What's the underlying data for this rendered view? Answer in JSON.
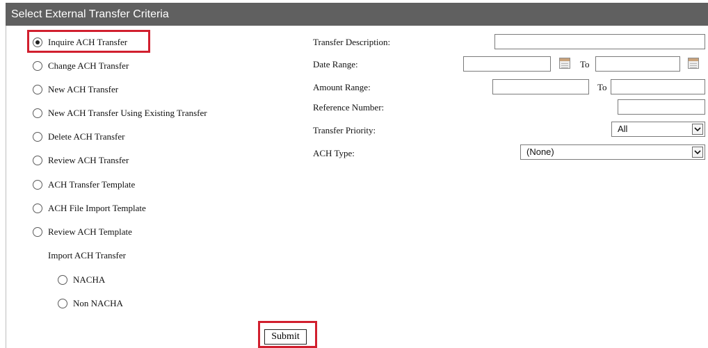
{
  "panel": {
    "title": "Select External Transfer Criteria"
  },
  "options": [
    {
      "label": "Inquire ACH Transfer",
      "checked": true
    },
    {
      "label": "Change ACH Transfer",
      "checked": false
    },
    {
      "label": "New ACH Transfer",
      "checked": false
    },
    {
      "label": "New ACH Transfer Using Existing Transfer",
      "checked": false
    },
    {
      "label": "Delete ACH Transfer",
      "checked": false
    },
    {
      "label": "Review ACH Transfer",
      "checked": false
    },
    {
      "label": "ACH Transfer Template",
      "checked": false
    },
    {
      "label": "ACH File Import Template",
      "checked": false
    },
    {
      "label": "Review ACH Template",
      "checked": false
    }
  ],
  "import_section": {
    "heading": "Import ACH Transfer",
    "options": [
      {
        "label": "NACHA",
        "checked": false
      },
      {
        "label": "Non NACHA",
        "checked": false
      }
    ]
  },
  "criteria": {
    "transfer_description": {
      "label": "Transfer Description:",
      "value": ""
    },
    "date_range": {
      "label": "Date Range:",
      "from": "",
      "to_label": "To",
      "to": ""
    },
    "amount_range": {
      "label": "Amount Range:",
      "from": "",
      "to_label": "To",
      "to": ""
    },
    "reference_number": {
      "label": "Reference Number:",
      "value": ""
    },
    "transfer_priority": {
      "label": "Transfer Priority:",
      "selected": "All"
    },
    "ach_type": {
      "label": "ACH Type:",
      "selected": "(None)"
    }
  },
  "actions": {
    "submit_label": "Submit"
  },
  "icons": {
    "calendar": "calendar-icon",
    "dropdown": "chevron-down-icon"
  },
  "colors": {
    "title_bar": "#606060",
    "highlight": "#d11f2e"
  }
}
